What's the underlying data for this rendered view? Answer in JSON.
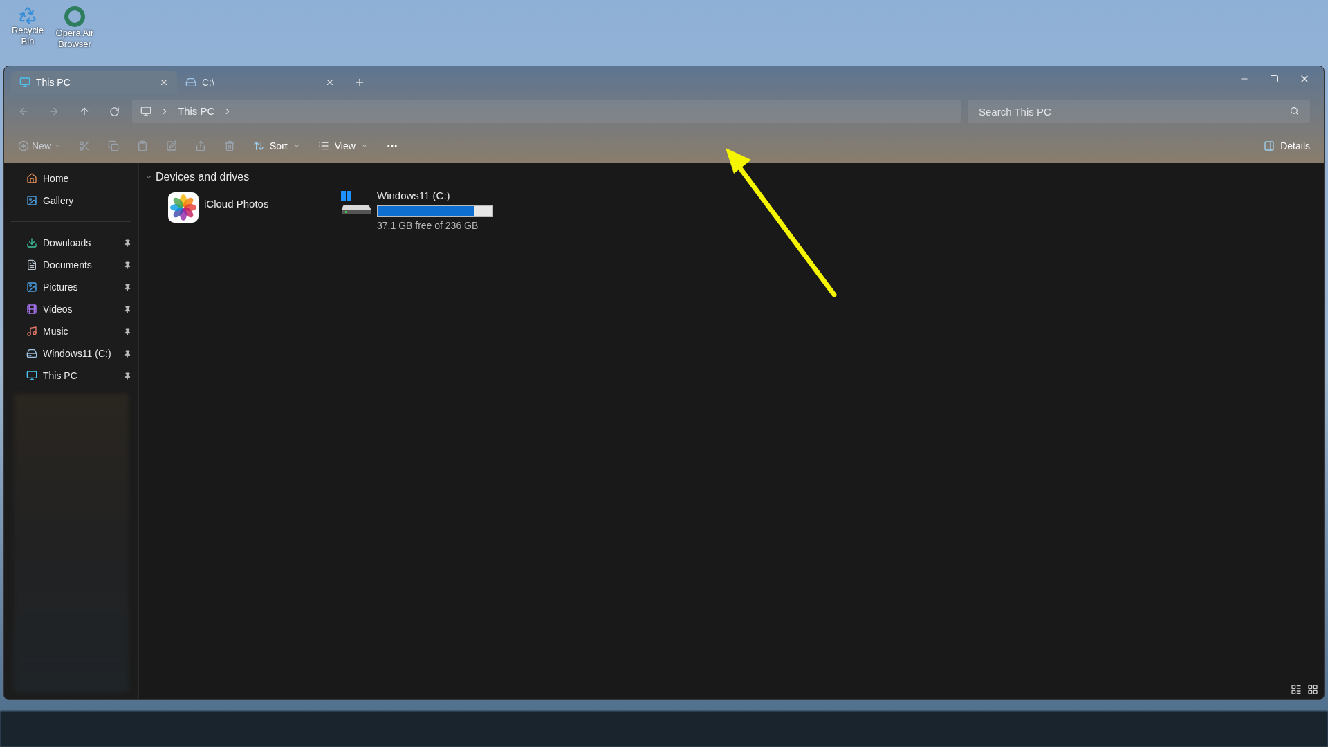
{
  "desktop_icons": [
    {
      "label": "Recycle Bin",
      "kind": "recycle"
    },
    {
      "label": "Opera Air Browser",
      "kind": "opera"
    }
  ],
  "tabs": [
    {
      "label": "This PC",
      "kind": "pc",
      "selected": true
    },
    {
      "label": "C:\\",
      "kind": "drive",
      "selected": false
    }
  ],
  "address": {
    "segments": [
      "This PC"
    ]
  },
  "search": {
    "placeholder": "Search This PC"
  },
  "toolbar": {
    "new": "New",
    "sort": "Sort",
    "view": "View",
    "details": "Details"
  },
  "sidebar": {
    "top": [
      {
        "label": "Home",
        "kind": "home"
      },
      {
        "label": "Gallery",
        "kind": "gallery"
      }
    ],
    "quick_access": [
      {
        "label": "Downloads",
        "kind": "downloads",
        "pinned": true
      },
      {
        "label": "Documents",
        "kind": "documents",
        "pinned": true
      },
      {
        "label": "Pictures",
        "kind": "pictures",
        "pinned": true
      },
      {
        "label": "Videos",
        "kind": "videos",
        "pinned": true
      },
      {
        "label": "Music",
        "kind": "music",
        "pinned": true
      },
      {
        "label": "Windows11 (C:)",
        "kind": "drive",
        "pinned": true
      },
      {
        "label": "This PC",
        "kind": "pc",
        "pinned": true
      }
    ]
  },
  "content": {
    "section": "Devices and drives",
    "expanded": true,
    "items": [
      {
        "kind": "app",
        "name": "iCloud Photos"
      },
      {
        "kind": "drive",
        "name": "Windows11 (C:)",
        "level": 0.84,
        "reading": "37.1 GB free of 236 GB"
      }
    ]
  }
}
